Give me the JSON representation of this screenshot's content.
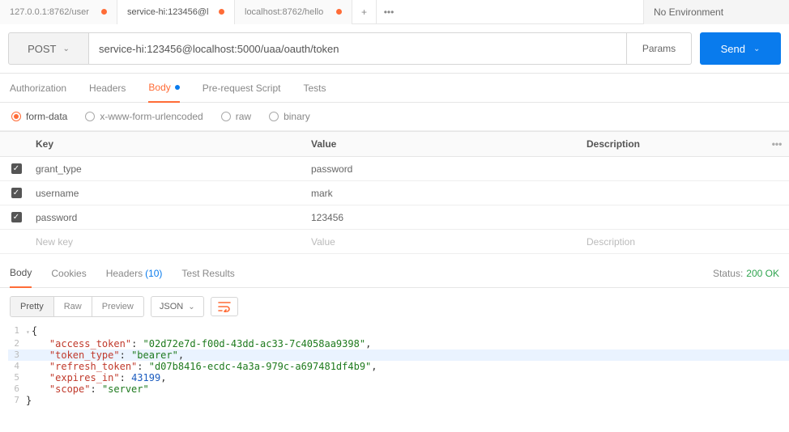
{
  "env": {
    "label": "No Environment"
  },
  "tabs": [
    {
      "label": "127.0.0.1:8762/user",
      "dirty": true,
      "active": false
    },
    {
      "label": "service-hi:123456@l",
      "dirty": true,
      "active": true
    },
    {
      "label": "localhost:8762/hello",
      "dirty": true,
      "active": false
    }
  ],
  "request": {
    "method": "POST",
    "url": "service-hi:123456@localhost:5000/uaa/oauth/token",
    "params_btn": "Params",
    "send_btn": "Send"
  },
  "req_tabs": {
    "auth": "Authorization",
    "headers": "Headers",
    "body": "Body",
    "prereq": "Pre-request Script",
    "tests": "Tests"
  },
  "body_types": {
    "formdata": "form-data",
    "urlencoded": "x-www-form-urlencoded",
    "raw": "raw",
    "binary": "binary"
  },
  "kv": {
    "head_key": "Key",
    "head_val": "Value",
    "head_desc": "Description",
    "rows": [
      {
        "key": "grant_type",
        "value": "password"
      },
      {
        "key": "username",
        "value": "mark"
      },
      {
        "key": "password",
        "value": "123456"
      }
    ],
    "new_key": "New key",
    "new_val": "Value",
    "new_desc": "Description"
  },
  "resp_tabs": {
    "body": "Body",
    "cookies": "Cookies",
    "headers": "Headers",
    "headers_count": "(10)",
    "tests": "Test Results"
  },
  "status": {
    "label": "Status:",
    "code": "200 OK"
  },
  "viewer": {
    "pretty": "Pretty",
    "raw": "Raw",
    "preview": "Preview",
    "fmt": "JSON"
  },
  "response_json": {
    "access_token": "02d72e7d-f00d-43dd-ac33-7c4058aa9398",
    "token_type": "bearer",
    "refresh_token": "d07b8416-ecdc-4a3a-979c-a697481df4b9",
    "expires_in": 43199,
    "scope": "server"
  }
}
